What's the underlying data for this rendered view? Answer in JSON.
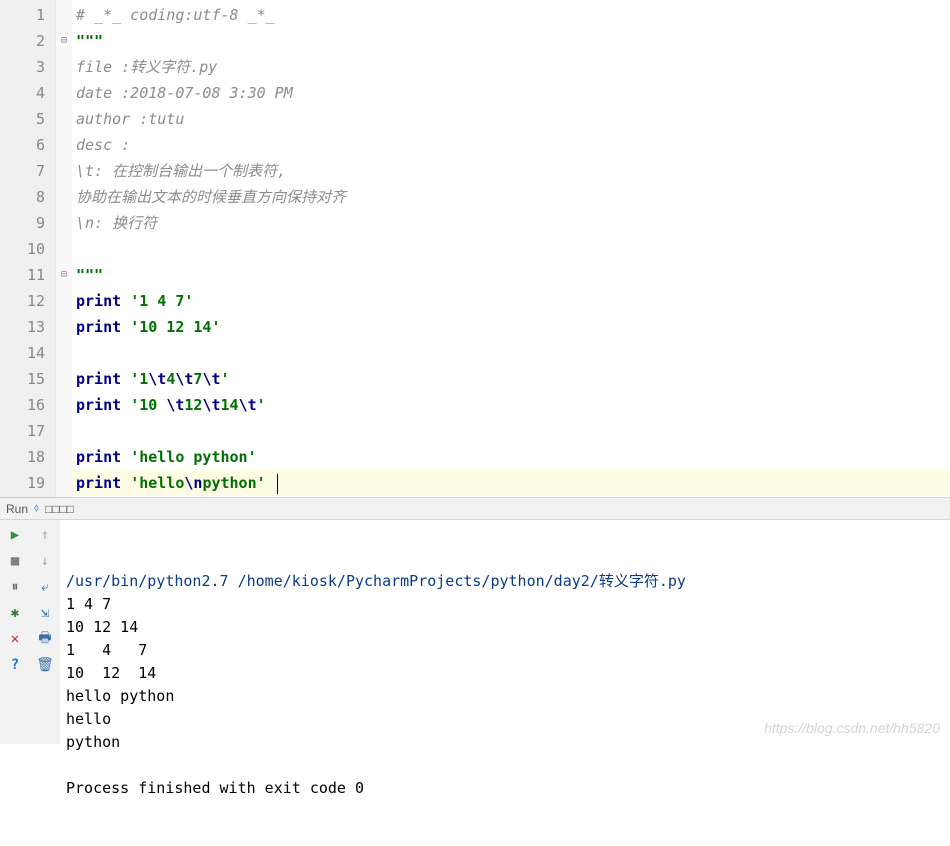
{
  "editor": {
    "lines": [
      {
        "n": "1",
        "seg": [
          {
            "t": "# _*_ coding:utf-8 _*_",
            "cls": "c-comment"
          }
        ]
      },
      {
        "n": "2",
        "fold": "⊟",
        "seg": [
          {
            "t": "\"\"\"",
            "cls": "c-str"
          }
        ]
      },
      {
        "n": "3",
        "seg": [
          {
            "t": "file :转义字符.py",
            "cls": "c-comment"
          }
        ]
      },
      {
        "n": "4",
        "seg": [
          {
            "t": "date :2018-07-08 3:30 PM",
            "cls": "c-comment"
          }
        ]
      },
      {
        "n": "5",
        "seg": [
          {
            "t": "author :tutu",
            "cls": "c-comment"
          }
        ]
      },
      {
        "n": "6",
        "seg": [
          {
            "t": "desc :",
            "cls": "c-comment"
          }
        ]
      },
      {
        "n": "7",
        "seg": [
          {
            "t": "\\t: 在控制台输出一个制表符,",
            "cls": "c-comment"
          }
        ]
      },
      {
        "n": "8",
        "seg": [
          {
            "t": "协助在输出文本的时候垂直方向保持对齐",
            "cls": "c-comment"
          }
        ]
      },
      {
        "n": "9",
        "seg": [
          {
            "t": "\\n: 换行符",
            "cls": "c-comment"
          }
        ]
      },
      {
        "n": "10",
        "seg": []
      },
      {
        "n": "11",
        "fold": "⊟",
        "seg": [
          {
            "t": "\"\"\"",
            "cls": "c-str"
          }
        ]
      },
      {
        "n": "12",
        "seg": [
          {
            "t": "print",
            "cls": "c-kw"
          },
          {
            "t": " "
          },
          {
            "t": "'1 4 7'",
            "cls": "c-str"
          }
        ]
      },
      {
        "n": "13",
        "seg": [
          {
            "t": "print",
            "cls": "c-kw"
          },
          {
            "t": " "
          },
          {
            "t": "'10 12 14'",
            "cls": "c-str"
          }
        ]
      },
      {
        "n": "14",
        "seg": []
      },
      {
        "n": "15",
        "seg": [
          {
            "t": "print",
            "cls": "c-kw"
          },
          {
            "t": " "
          },
          {
            "t": "'1",
            "cls": "c-str"
          },
          {
            "t": "\\t",
            "cls": "c-esc"
          },
          {
            "t": "4",
            "cls": "c-str"
          },
          {
            "t": "\\t",
            "cls": "c-esc"
          },
          {
            "t": "7",
            "cls": "c-str"
          },
          {
            "t": "\\t",
            "cls": "c-esc"
          },
          {
            "t": "'",
            "cls": "c-str"
          }
        ]
      },
      {
        "n": "16",
        "seg": [
          {
            "t": "print",
            "cls": "c-kw"
          },
          {
            "t": " "
          },
          {
            "t": "'10 ",
            "cls": "c-str"
          },
          {
            "t": "\\t",
            "cls": "c-esc"
          },
          {
            "t": "12",
            "cls": "c-str"
          },
          {
            "t": "\\t",
            "cls": "c-esc"
          },
          {
            "t": "14",
            "cls": "c-str"
          },
          {
            "t": "\\t",
            "cls": "c-esc"
          },
          {
            "t": "'",
            "cls": "c-str"
          }
        ]
      },
      {
        "n": "17",
        "seg": []
      },
      {
        "n": "18",
        "seg": [
          {
            "t": "print",
            "cls": "c-kw"
          },
          {
            "t": " "
          },
          {
            "t": "'hello python'",
            "cls": "c-str"
          }
        ]
      },
      {
        "n": "19",
        "hl": true,
        "caret": true,
        "seg": [
          {
            "t": "print",
            "cls": "c-kw"
          },
          {
            "t": " "
          },
          {
            "t": "'hello",
            "cls": "c-str"
          },
          {
            "t": "\\n",
            "cls": "c-esc"
          },
          {
            "t": "python'",
            "cls": "c-str"
          }
        ]
      }
    ]
  },
  "run": {
    "label": "Run",
    "config": "□□□□",
    "command": "/usr/bin/python2.7 /home/kiosk/PycharmProjects/python/day2/转义字符.py",
    "output": [
      "1 4 7",
      "10 12 14",
      "1   4   7",
      "10  12  14",
      "hello python",
      "hello",
      "python",
      "",
      "Process finished with exit code 0"
    ]
  },
  "watermark": "https://blog.csdn.net/hh5820"
}
